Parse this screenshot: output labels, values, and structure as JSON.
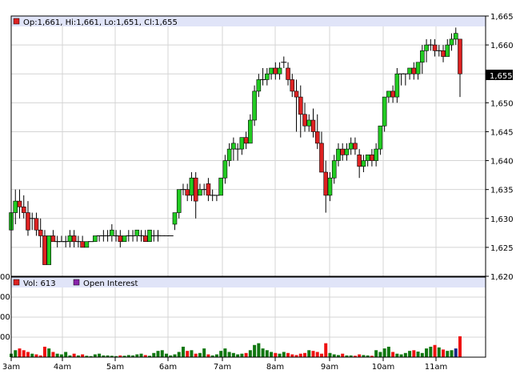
{
  "price_panel": {
    "legend": "Op:1,661, Hi:1,661, Lo:1,651, Cl:1,655",
    "last_price_label": "1,655",
    "y_tick_labels": [
      "1,665",
      "1,660",
      "1,655",
      "1,650",
      "1,645",
      "1,640",
      "1,635",
      "1,630",
      "1,625",
      "1,620"
    ]
  },
  "volume_panel": {
    "legend_vol": "Vol: 613",
    "legend_oi": "Open Interest",
    "y_tick_labels": [
      "00",
      "00",
      "00",
      "00"
    ]
  },
  "x_axis": {
    "labels": [
      "3am",
      "4am",
      "5am",
      "6am",
      "7am",
      "8am",
      "9am",
      "10am",
      "11am"
    ]
  },
  "colors": {
    "up": "#22cc22",
    "down": "#dd2222",
    "oi": "#8822aa",
    "header_band": "#e0e4f8",
    "grid": "#d4d4d4"
  },
  "chart_data": [
    {
      "type": "candlestick",
      "title": "",
      "ylim": [
        1620,
        1665
      ],
      "x_labels": [
        "3am",
        "4am",
        "5am",
        "6am",
        "7am",
        "8am",
        "9am",
        "10am",
        "11am"
      ],
      "ohlc": [
        [
          1628,
          1634,
          1627,
          1631
        ],
        [
          1631,
          1635,
          1629,
          1633
        ],
        [
          1633,
          1635,
          1630,
          1632
        ],
        [
          1632,
          1634,
          1630,
          1631
        ],
        [
          1631,
          1633,
          1627,
          1628
        ],
        [
          1630,
          1631,
          1628,
          1630
        ],
        [
          1630,
          1631,
          1627,
          1628
        ],
        [
          1628,
          1630,
          1625,
          1627
        ],
        [
          1627,
          1628,
          1622,
          1622
        ],
        [
          1622,
          1627,
          1622,
          1627
        ],
        [
          1627,
          1628,
          1626,
          1626
        ],
        [
          1626,
          1627,
          1625,
          1626
        ],
        [
          1626,
          1627,
          1626,
          1626
        ],
        [
          1626,
          1627,
          1625,
          1626
        ],
        [
          1626,
          1628,
          1625,
          1627
        ],
        [
          1627,
          1628,
          1625,
          1626
        ],
        [
          1626,
          1627,
          1625,
          1626
        ],
        [
          1626,
          1627,
          1625,
          1625
        ],
        [
          1625,
          1626,
          1625,
          1626
        ],
        [
          1626,
          1626,
          1626,
          1626
        ],
        [
          1626,
          1627,
          1626,
          1627
        ],
        [
          1627,
          1627,
          1626,
          1627
        ],
        [
          1627,
          1628,
          1626,
          1627
        ],
        [
          1627,
          1628,
          1626,
          1627
        ],
        [
          1627,
          1629,
          1626,
          1628
        ],
        [
          1627,
          1628,
          1626,
          1627
        ],
        [
          1627,
          1628,
          1625,
          1626
        ],
        [
          1626,
          1627,
          1626,
          1627
        ],
        [
          1627,
          1628,
          1626,
          1627
        ],
        [
          1627,
          1628,
          1626,
          1627
        ],
        [
          1627,
          1628,
          1626,
          1628
        ],
        [
          1627,
          1628,
          1626,
          1627
        ],
        [
          1627,
          1628,
          1626,
          1626
        ],
        [
          1626,
          1628,
          1626,
          1628
        ],
        [
          1627,
          1628,
          1626,
          1627
        ],
        [
          1627,
          1628,
          1626,
          1627
        ],
        [
          1627,
          1627,
          1627,
          1627
        ],
        [
          1627,
          1627,
          1627,
          1627
        ],
        [
          1627,
          1627,
          1627,
          1627
        ],
        [
          1629,
          1631,
          1628,
          1631
        ],
        [
          1631,
          1635,
          1630,
          1635
        ],
        [
          1635,
          1636,
          1634,
          1635
        ],
        [
          1635,
          1636,
          1633,
          1634
        ],
        [
          1634,
          1638,
          1633,
          1637
        ],
        [
          1637,
          1638,
          1630,
          1633
        ],
        [
          1634,
          1636,
          1634,
          1635
        ],
        [
          1635,
          1636,
          1634,
          1635
        ],
        [
          1636,
          1637,
          1633,
          1634
        ],
        [
          1634,
          1635,
          1633,
          1634
        ],
        [
          1634,
          1634,
          1633,
          1634
        ],
        [
          1634,
          1637,
          1634,
          1637
        ],
        [
          1637,
          1641,
          1636,
          1640
        ],
        [
          1640,
          1643,
          1639,
          1642
        ],
        [
          1642,
          1644,
          1640,
          1643
        ],
        [
          1642,
          1643,
          1640,
          1642
        ],
        [
          1642,
          1644,
          1641,
          1644
        ],
        [
          1644,
          1645,
          1642,
          1643
        ],
        [
          1643,
          1648,
          1643,
          1647
        ],
        [
          1647,
          1653,
          1646,
          1652
        ],
        [
          1652,
          1655,
          1651,
          1654
        ],
        [
          1654,
          1656,
          1653,
          1654
        ],
        [
          1654,
          1656,
          1653,
          1655
        ],
        [
          1655,
          1656,
          1654,
          1656
        ],
        [
          1656,
          1657,
          1654,
          1655
        ],
        [
          1655,
          1657,
          1654,
          1656
        ],
        [
          1657,
          1658,
          1656,
          1657
        ],
        [
          1656,
          1657,
          1653,
          1654
        ],
        [
          1654,
          1655,
          1651,
          1652
        ],
        [
          1652,
          1654,
          1645,
          1651
        ],
        [
          1651,
          1653,
          1644,
          1648
        ],
        [
          1648,
          1650,
          1645,
          1646
        ],
        [
          1646,
          1648,
          1645,
          1647
        ],
        [
          1647,
          1649,
          1644,
          1645
        ],
        [
          1645,
          1648,
          1642,
          1643
        ],
        [
          1643,
          1645,
          1638,
          1638
        ],
        [
          1638,
          1640,
          1631,
          1634
        ],
        [
          1634,
          1638,
          1633,
          1637
        ],
        [
          1637,
          1641,
          1636,
          1640
        ],
        [
          1640,
          1643,
          1639,
          1642
        ],
        [
          1642,
          1643,
          1640,
          1641
        ],
        [
          1641,
          1643,
          1640,
          1642
        ],
        [
          1642,
          1644,
          1641,
          1643
        ],
        [
          1643,
          1644,
          1641,
          1642
        ],
        [
          1641,
          1642,
          1637,
          1639
        ],
        [
          1639,
          1641,
          1638,
          1640
        ],
        [
          1640,
          1641,
          1639,
          1641
        ],
        [
          1641,
          1642,
          1639,
          1640
        ],
        [
          1640,
          1643,
          1639,
          1642
        ],
        [
          1642,
          1646,
          1641,
          1646
        ],
        [
          1646,
          1651,
          1645,
          1651
        ],
        [
          1651,
          1652,
          1650,
          1652
        ],
        [
          1652,
          1653,
          1650,
          1651
        ],
        [
          1651,
          1656,
          1650,
          1655
        ],
        [
          1655,
          1655,
          1653,
          1655
        ],
        [
          1655,
          1655,
          1653,
          1655
        ],
        [
          1655,
          1656,
          1654,
          1656
        ],
        [
          1656,
          1657,
          1654,
          1655
        ],
        [
          1655,
          1657,
          1654,
          1657
        ],
        [
          1657,
          1660,
          1655,
          1659
        ],
        [
          1659,
          1661,
          1657,
          1660
        ],
        [
          1660,
          1661,
          1659,
          1660
        ],
        [
          1660,
          1661,
          1658,
          1659
        ],
        [
          1659,
          1660,
          1658,
          1659
        ],
        [
          1659,
          1660,
          1657,
          1658
        ],
        [
          1658,
          1661,
          1658,
          1660
        ],
        [
          1660,
          1662,
          1659,
          1661
        ],
        [
          1661,
          1663,
          1660,
          1662
        ],
        [
          1661,
          1661,
          1651,
          1655
        ]
      ]
    },
    {
      "type": "bar",
      "title": "",
      "series": [
        {
          "name": "Vol",
          "values": [
            10,
            20,
            25,
            20,
            15,
            10,
            8,
            5,
            30,
            25,
            15,
            10,
            8,
            15,
            5,
            10,
            5,
            8,
            4,
            3,
            8,
            10,
            5,
            5,
            4,
            3,
            5,
            4,
            6,
            5,
            8,
            10,
            6,
            4,
            12,
            18,
            20,
            10,
            5,
            8,
            15,
            30,
            18,
            20,
            10,
            12,
            25,
            8,
            5,
            8,
            18,
            25,
            15,
            12,
            8,
            10,
            12,
            20,
            35,
            40,
            25,
            20,
            15,
            12,
            10,
            15,
            12,
            8,
            6,
            10,
            12,
            20,
            18,
            15,
            10,
            40,
            12,
            8,
            6,
            10,
            5,
            5,
            4,
            8,
            6,
            5,
            4,
            20,
            15,
            25,
            30,
            15,
            10,
            8,
            12,
            18,
            20,
            16,
            12,
            25,
            30,
            35,
            28,
            22,
            18,
            20,
            25,
            60,
            190
          ]
        }
      ]
    }
  ]
}
